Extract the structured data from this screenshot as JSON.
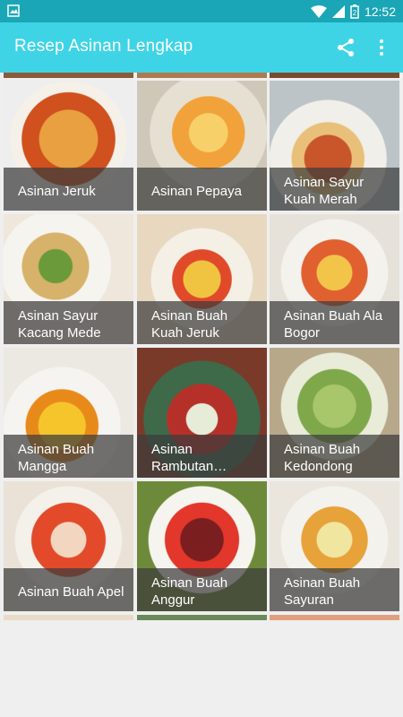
{
  "statusbar": {
    "time": "12:52",
    "battery_level": "2"
  },
  "appbar": {
    "title": "Resep Asinan Lengkap"
  },
  "recipes": [
    {
      "label": "Asinan Jeruk"
    },
    {
      "label": "Asinan Pepaya"
    },
    {
      "label": "Asinan Sayur Kuah Merah"
    },
    {
      "label": "Asinan Sayur Kacang Mede"
    },
    {
      "label": "Asinan Buah Kuah Jeruk"
    },
    {
      "label": "Asinan Buah Ala Bogor"
    },
    {
      "label": "Asinan Buah Mangga"
    },
    {
      "label": "Asinan Rambutan…"
    },
    {
      "label": "Asinan Buah Kedondong"
    },
    {
      "label": "Asinan Buah Apel"
    },
    {
      "label": "Asinan Buah Anggur"
    },
    {
      "label": "Asinan Buah Sayuran"
    }
  ],
  "colors": {
    "statusbar": "#1aa6b7",
    "appbar": "#3ed4e6",
    "background": "#efefef"
  }
}
